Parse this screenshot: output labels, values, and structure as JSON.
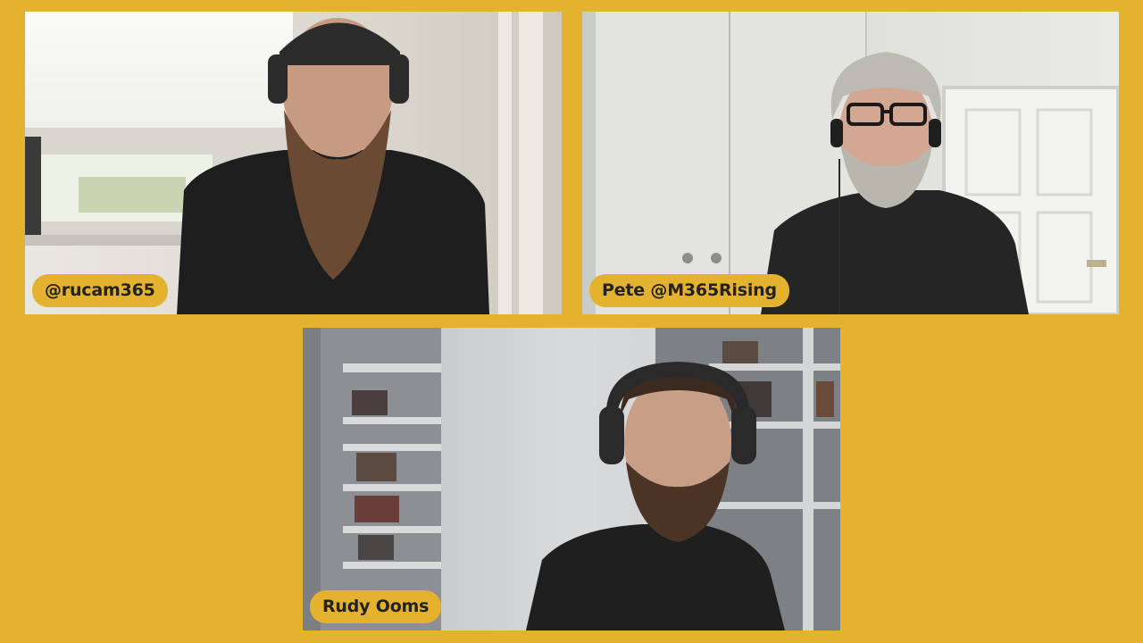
{
  "colors": {
    "background": "#e4b22e",
    "name_tag_bg": "#e4b22e",
    "name_tag_text": "#222222"
  },
  "participants": [
    {
      "name": "@rucam365"
    },
    {
      "name": "Pete @M365Rising"
    },
    {
      "name": "Rudy Ooms"
    }
  ]
}
